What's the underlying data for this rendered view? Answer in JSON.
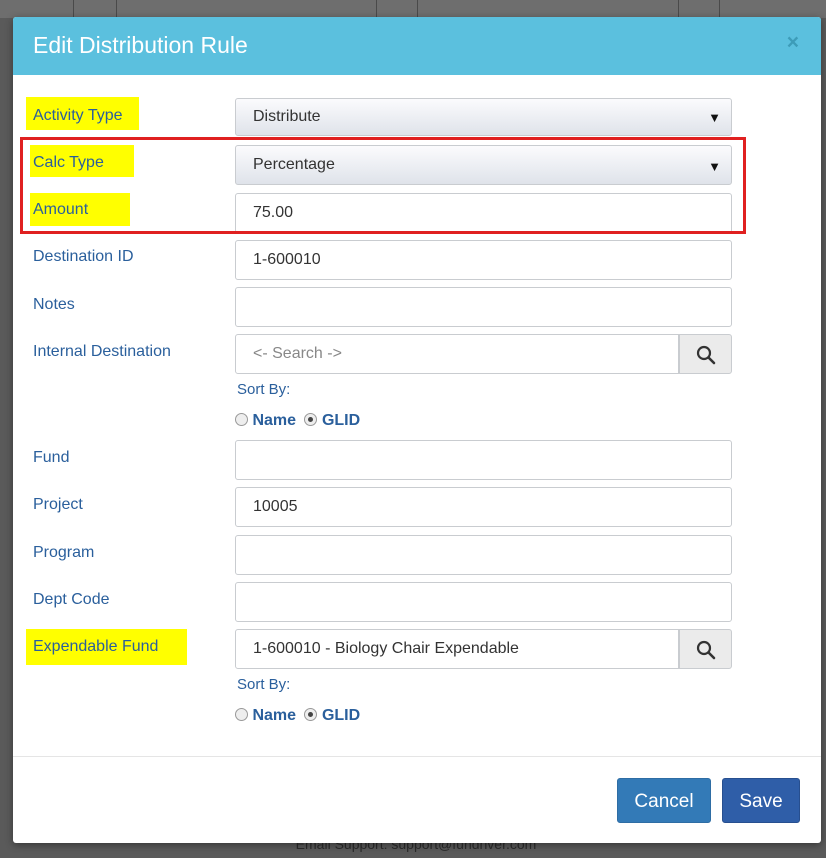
{
  "background": {
    "footer_text": "Email Support: support@fundriver.com"
  },
  "modal": {
    "title": "Edit Distribution Rule",
    "close_symbol": "×",
    "fields": {
      "activity_type": {
        "label": "Activity Type",
        "value": "Distribute",
        "highlighted": true
      },
      "calc_type": {
        "label": "Calc Type",
        "value": "Percentage",
        "highlighted": true
      },
      "amount": {
        "label": "Amount",
        "value": "75.00",
        "highlighted": true
      },
      "destination_id": {
        "label": "Destination ID",
        "value": "1-600010"
      },
      "notes": {
        "label": "Notes",
        "value": ""
      },
      "internal_destination": {
        "label": "Internal Destination",
        "placeholder": "<- Search ->"
      },
      "fund": {
        "label": "Fund",
        "value": ""
      },
      "project": {
        "label": "Project",
        "value": "10005"
      },
      "program": {
        "label": "Program",
        "value": ""
      },
      "dept_code": {
        "label": "Dept Code",
        "value": ""
      },
      "expendable_fund": {
        "label": "Expendable Fund",
        "value": "1-600010 - Biology Chair Expendable",
        "highlighted": true
      }
    },
    "sort_by": {
      "label": "Sort By:",
      "options": [
        "Name",
        "GLID"
      ],
      "selected": "GLID"
    },
    "buttons": {
      "cancel": "Cancel",
      "save": "Save"
    }
  },
  "colors": {
    "header": "#5bc0de",
    "highlight": "#ffff00",
    "annotation_box": "#e02020",
    "label": "#2a5f9c"
  }
}
